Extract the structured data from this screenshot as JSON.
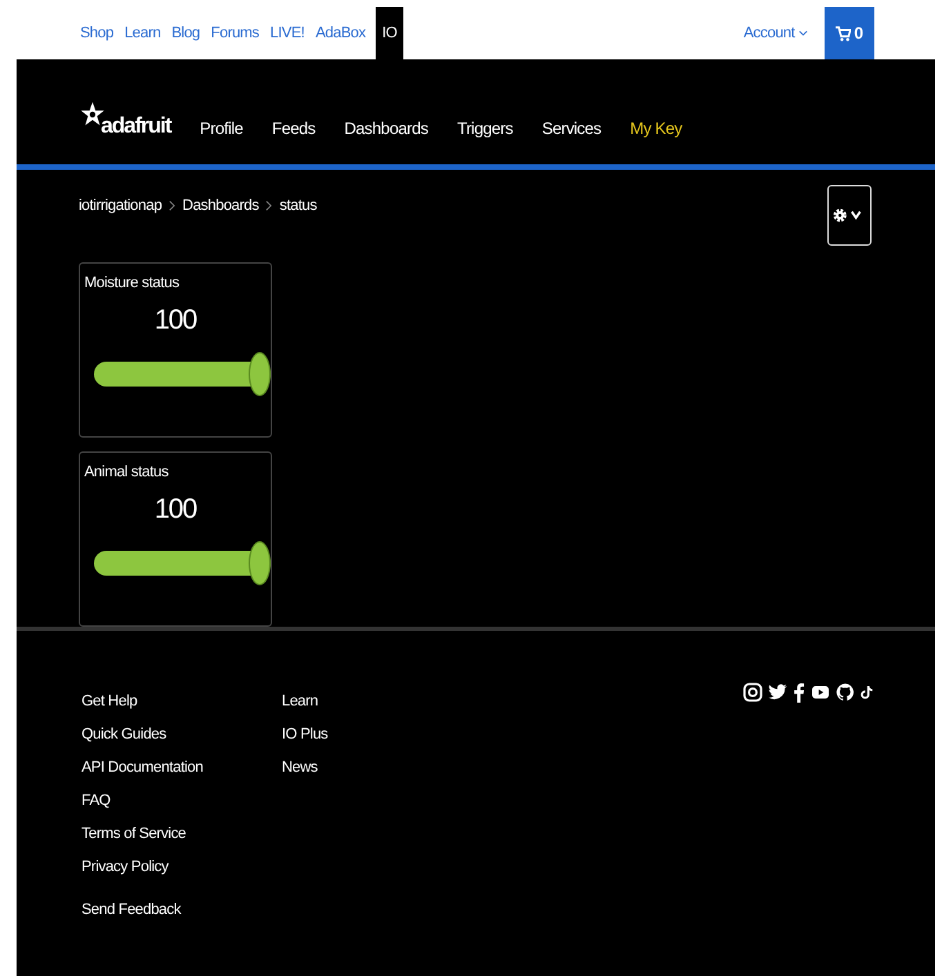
{
  "top_bar": {
    "links": [
      {
        "label": "Shop",
        "selected": false
      },
      {
        "label": "Learn",
        "selected": false
      },
      {
        "label": "Blog",
        "selected": false
      },
      {
        "label": "Forums",
        "selected": false
      },
      {
        "label": "LIVE!",
        "selected": false
      },
      {
        "label": "AdaBox",
        "selected": false
      },
      {
        "label": "IO",
        "selected": true
      }
    ],
    "account": "Account",
    "cart_count": "0"
  },
  "main_nav": {
    "brand": "adafruit",
    "items": [
      {
        "label": "Profile",
        "highlighted": false
      },
      {
        "label": "Feeds",
        "highlighted": false
      },
      {
        "label": "Dashboards",
        "highlighted": false
      },
      {
        "label": "Triggers",
        "highlighted": false
      },
      {
        "label": "Services",
        "highlighted": false
      },
      {
        "label": "My Key",
        "highlighted": true
      }
    ]
  },
  "breadcrumb": [
    "iotirrigationap",
    "Dashboards",
    "status"
  ],
  "blocks": [
    {
      "title": "Moisture status",
      "value": "100",
      "level": 1
    },
    {
      "title": "Animal status",
      "value": "100",
      "level": 1
    }
  ],
  "footer": {
    "column_1": [
      "Get Help",
      "Quick Guides",
      "API Documentation",
      "FAQ",
      "Terms of Service",
      "Privacy Policy"
    ],
    "column_2": [
      "Learn",
      "IO Plus",
      "News"
    ],
    "feedback": "Send Feedback"
  }
}
